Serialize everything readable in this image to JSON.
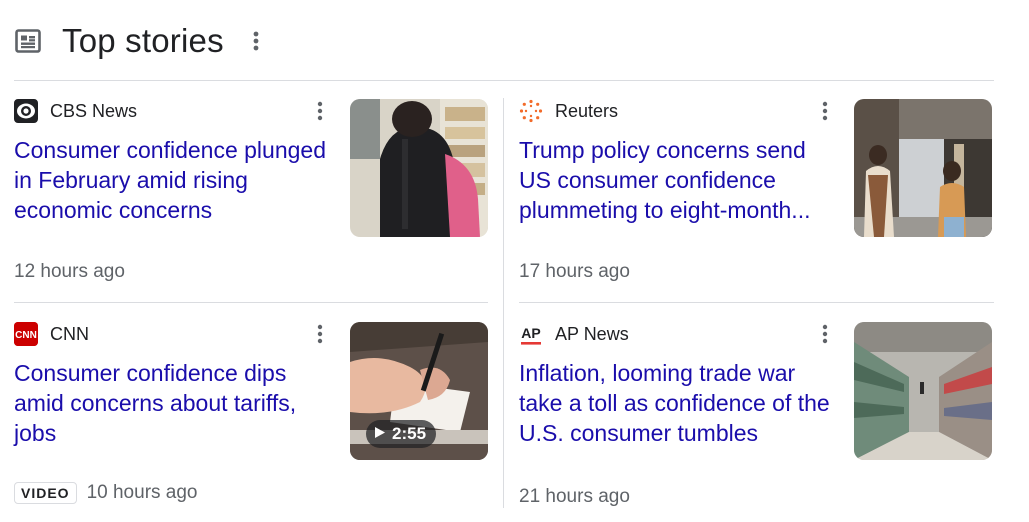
{
  "section": {
    "title": "Top stories",
    "icon": "newspaper-icon"
  },
  "colors": {
    "headline": "#1a0dab",
    "meta": "#5f6368",
    "divider": "#dadce0",
    "cnn_red": "#cc0000"
  },
  "stories": [
    {
      "source": "CBS News",
      "favicon": "cbs-eye-icon",
      "headline": "Consumer confidence plunged in February amid rising economic concerns",
      "time": "12 hours ago",
      "thumbnail": "shopper-in-store-photo"
    },
    {
      "source": "Reuters",
      "favicon": "reuters-dots-icon",
      "headline": "Trump policy concerns send US consumer confidence plummeting to eight-month...",
      "time": "17 hours ago",
      "thumbnail": "pedestrians-street-photo"
    },
    {
      "source": "CNN",
      "favicon": "cnn-logo-icon",
      "headline": "Consumer confidence dips amid concerns about tariffs, jobs",
      "badge": "VIDEO",
      "time": "10 hours ago",
      "duration": "2:55",
      "thumbnail": "hand-writing-video-still"
    },
    {
      "source": "AP News",
      "favicon": "ap-logo-icon",
      "headline": "Inflation, looming trade war take a toll as confidence of the U.S. consumer tumbles",
      "time": "21 hours ago",
      "thumbnail": "warehouse-aisle-photo"
    }
  ]
}
